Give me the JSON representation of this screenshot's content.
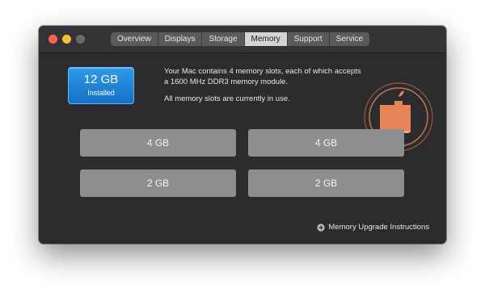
{
  "tabs": [
    "Overview",
    "Displays",
    "Storage",
    "Memory",
    "Support",
    "Service"
  ],
  "active_tab": "Memory",
  "installed": {
    "size": "12 GB",
    "label": "Installed"
  },
  "description": {
    "line1": "Your Mac contains 4 memory slots, each of which accepts",
    "line2": "a 1600 MHz DDR3 memory module.",
    "status": "All memory slots are currently in use."
  },
  "slots": [
    "4 GB",
    "4 GB",
    "2 GB",
    "2 GB"
  ],
  "upgrade_link": "Memory Upgrade Instructions",
  "icons": {
    "window_controls": [
      "close-icon",
      "minimize-icon",
      "zoom-icon"
    ],
    "memory_chip": "memory-chip-icon",
    "upgrade_arrow": "arrow-circle-right-icon"
  },
  "colors": {
    "window": "#2c2c2e",
    "accent_blue": "#1670c8",
    "chip_orange": "#e8845a",
    "slot_gray": "#8e8e90"
  }
}
